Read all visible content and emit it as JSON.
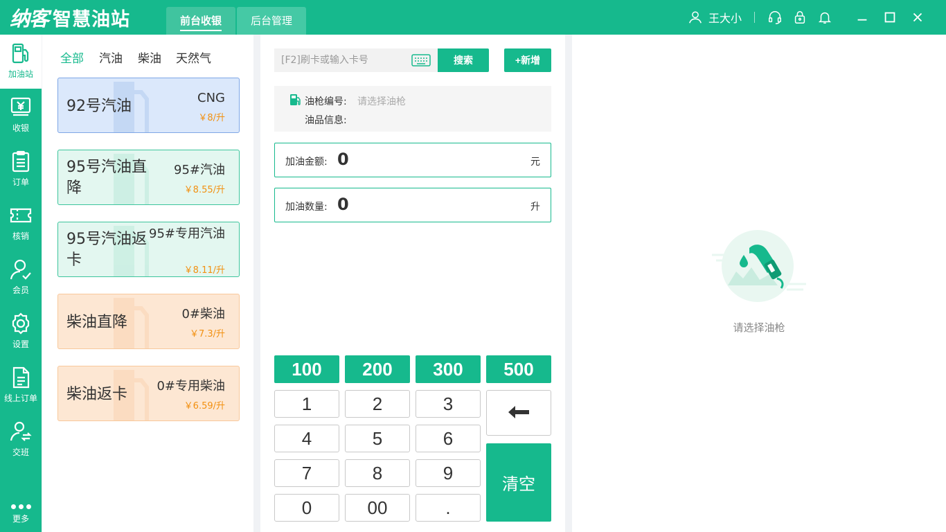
{
  "app": {
    "brand": "纳客",
    "subtitle": "智慧油站",
    "tabs": [
      {
        "label": "前台收银",
        "active": true
      },
      {
        "label": "后台管理",
        "active": false
      }
    ],
    "user": "王大小",
    "accent_color": "#16b98d"
  },
  "sidebar": {
    "items": [
      {
        "label": "加油站",
        "icon": "fuel-pump-icon",
        "active": true
      },
      {
        "label": "收银",
        "icon": "cashier-icon"
      },
      {
        "label": "订单",
        "icon": "order-icon"
      },
      {
        "label": "核销",
        "icon": "ticket-icon"
      },
      {
        "label": "会员",
        "icon": "member-icon"
      },
      {
        "label": "设置",
        "icon": "gear-icon"
      },
      {
        "label": "线上订单",
        "icon": "document-icon"
      },
      {
        "label": "交班",
        "icon": "shift-icon"
      }
    ],
    "more_label": "更多"
  },
  "oil_filters": [
    {
      "label": "全部",
      "active": true
    },
    {
      "label": "汽油"
    },
    {
      "label": "柴油"
    },
    {
      "label": "天然气"
    }
  ],
  "oils": [
    {
      "name": "92号汽油",
      "type": "CNG",
      "price": "￥8/升",
      "color": "blue"
    },
    {
      "name": "95号汽油直降",
      "type": "95#汽油",
      "price": "￥8.55/升",
      "color": "green"
    },
    {
      "name": "95号汽油返卡",
      "type": "95#专用汽油",
      "price": "￥8.11/升",
      "color": "green"
    },
    {
      "name": "柴油直降",
      "type": "0#柴油",
      "price": "￥7.3/升",
      "color": "orange"
    },
    {
      "name": "柴油返卡",
      "type": "0#专用柴油",
      "price": "￥6.59/升",
      "color": "orange"
    }
  ],
  "search": {
    "placeholder": "[F2]刷卡或输入卡号",
    "button": "搜索",
    "add_button": "+新增"
  },
  "gun": {
    "number_label": "油枪编号:",
    "number_placeholder": "请选择油枪",
    "info_label": "油品信息:"
  },
  "fuel_amount": {
    "label": "加油金额:",
    "value": "0",
    "unit": "元"
  },
  "fuel_volume": {
    "label": "加油数量:",
    "value": "0",
    "unit": "升"
  },
  "quick_amounts": [
    "100",
    "200",
    "300",
    "500"
  ],
  "keypad": [
    "1",
    "2",
    "3",
    "4",
    "5",
    "6",
    "7",
    "8",
    "9",
    "0",
    "00",
    "."
  ],
  "clear_label": "清空",
  "empty_state": {
    "text": "请选择油枪"
  }
}
